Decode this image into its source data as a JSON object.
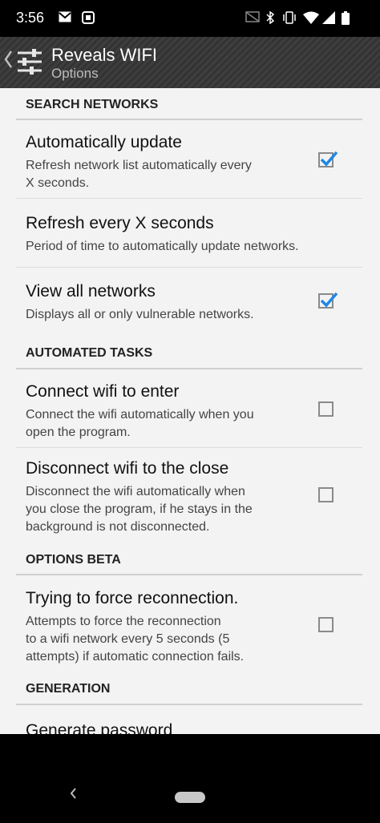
{
  "status_bar": {
    "time": "3:56",
    "icons": [
      "gmail-icon",
      "screenshot-icon",
      "cast-icon",
      "bluetooth-icon",
      "vibrate-icon",
      "wifi-icon",
      "signal-icon",
      "battery-icon"
    ]
  },
  "action_bar": {
    "title": "Reveals WIFI",
    "subtitle": "Options"
  },
  "sections": {
    "search": "SEARCH NETWORKS",
    "automated": "AUTOMATED TASKS",
    "beta": "OPTIONS BETA",
    "generation": "GENERATION"
  },
  "prefs": {
    "auto_update": {
      "title": "Automatically update",
      "summary_line1": "Refresh network list automatically every",
      "summary_line2": "X seconds.",
      "checked": true
    },
    "refresh_every": {
      "title": "Refresh every X seconds",
      "summary_line1": "Period of time to automatically update networks."
    },
    "view_all": {
      "title": "View all networks",
      "summary_line1": "Displays all or only vulnerable networks.",
      "checked": true
    },
    "connect_enter": {
      "title": "Connect wifi to enter",
      "summary_line1": "Connect the wifi automatically when you",
      "summary_line2": "open the program.",
      "checked": false
    },
    "disconnect_close": {
      "title": "Disconnect wifi to the close",
      "summary_line1": "Disconnect the wifi automatically when",
      "summary_line2": "you close the program, if he stays in the",
      "summary_line3": "background is not disconnected.",
      "checked": false
    },
    "force_reconnect": {
      "title": "Trying to force reconnection.",
      "summary_line1": "Attempts to force the reconnection",
      "summary_line2": "to a wifi network every 5 seconds (5",
      "summary_line3": "attempts) if automatic connection fails.",
      "checked": false
    },
    "generate_password": {
      "title": "Generate password"
    }
  },
  "colors": {
    "accent_check": "#1e88e5",
    "background": "#f3f3f3"
  }
}
